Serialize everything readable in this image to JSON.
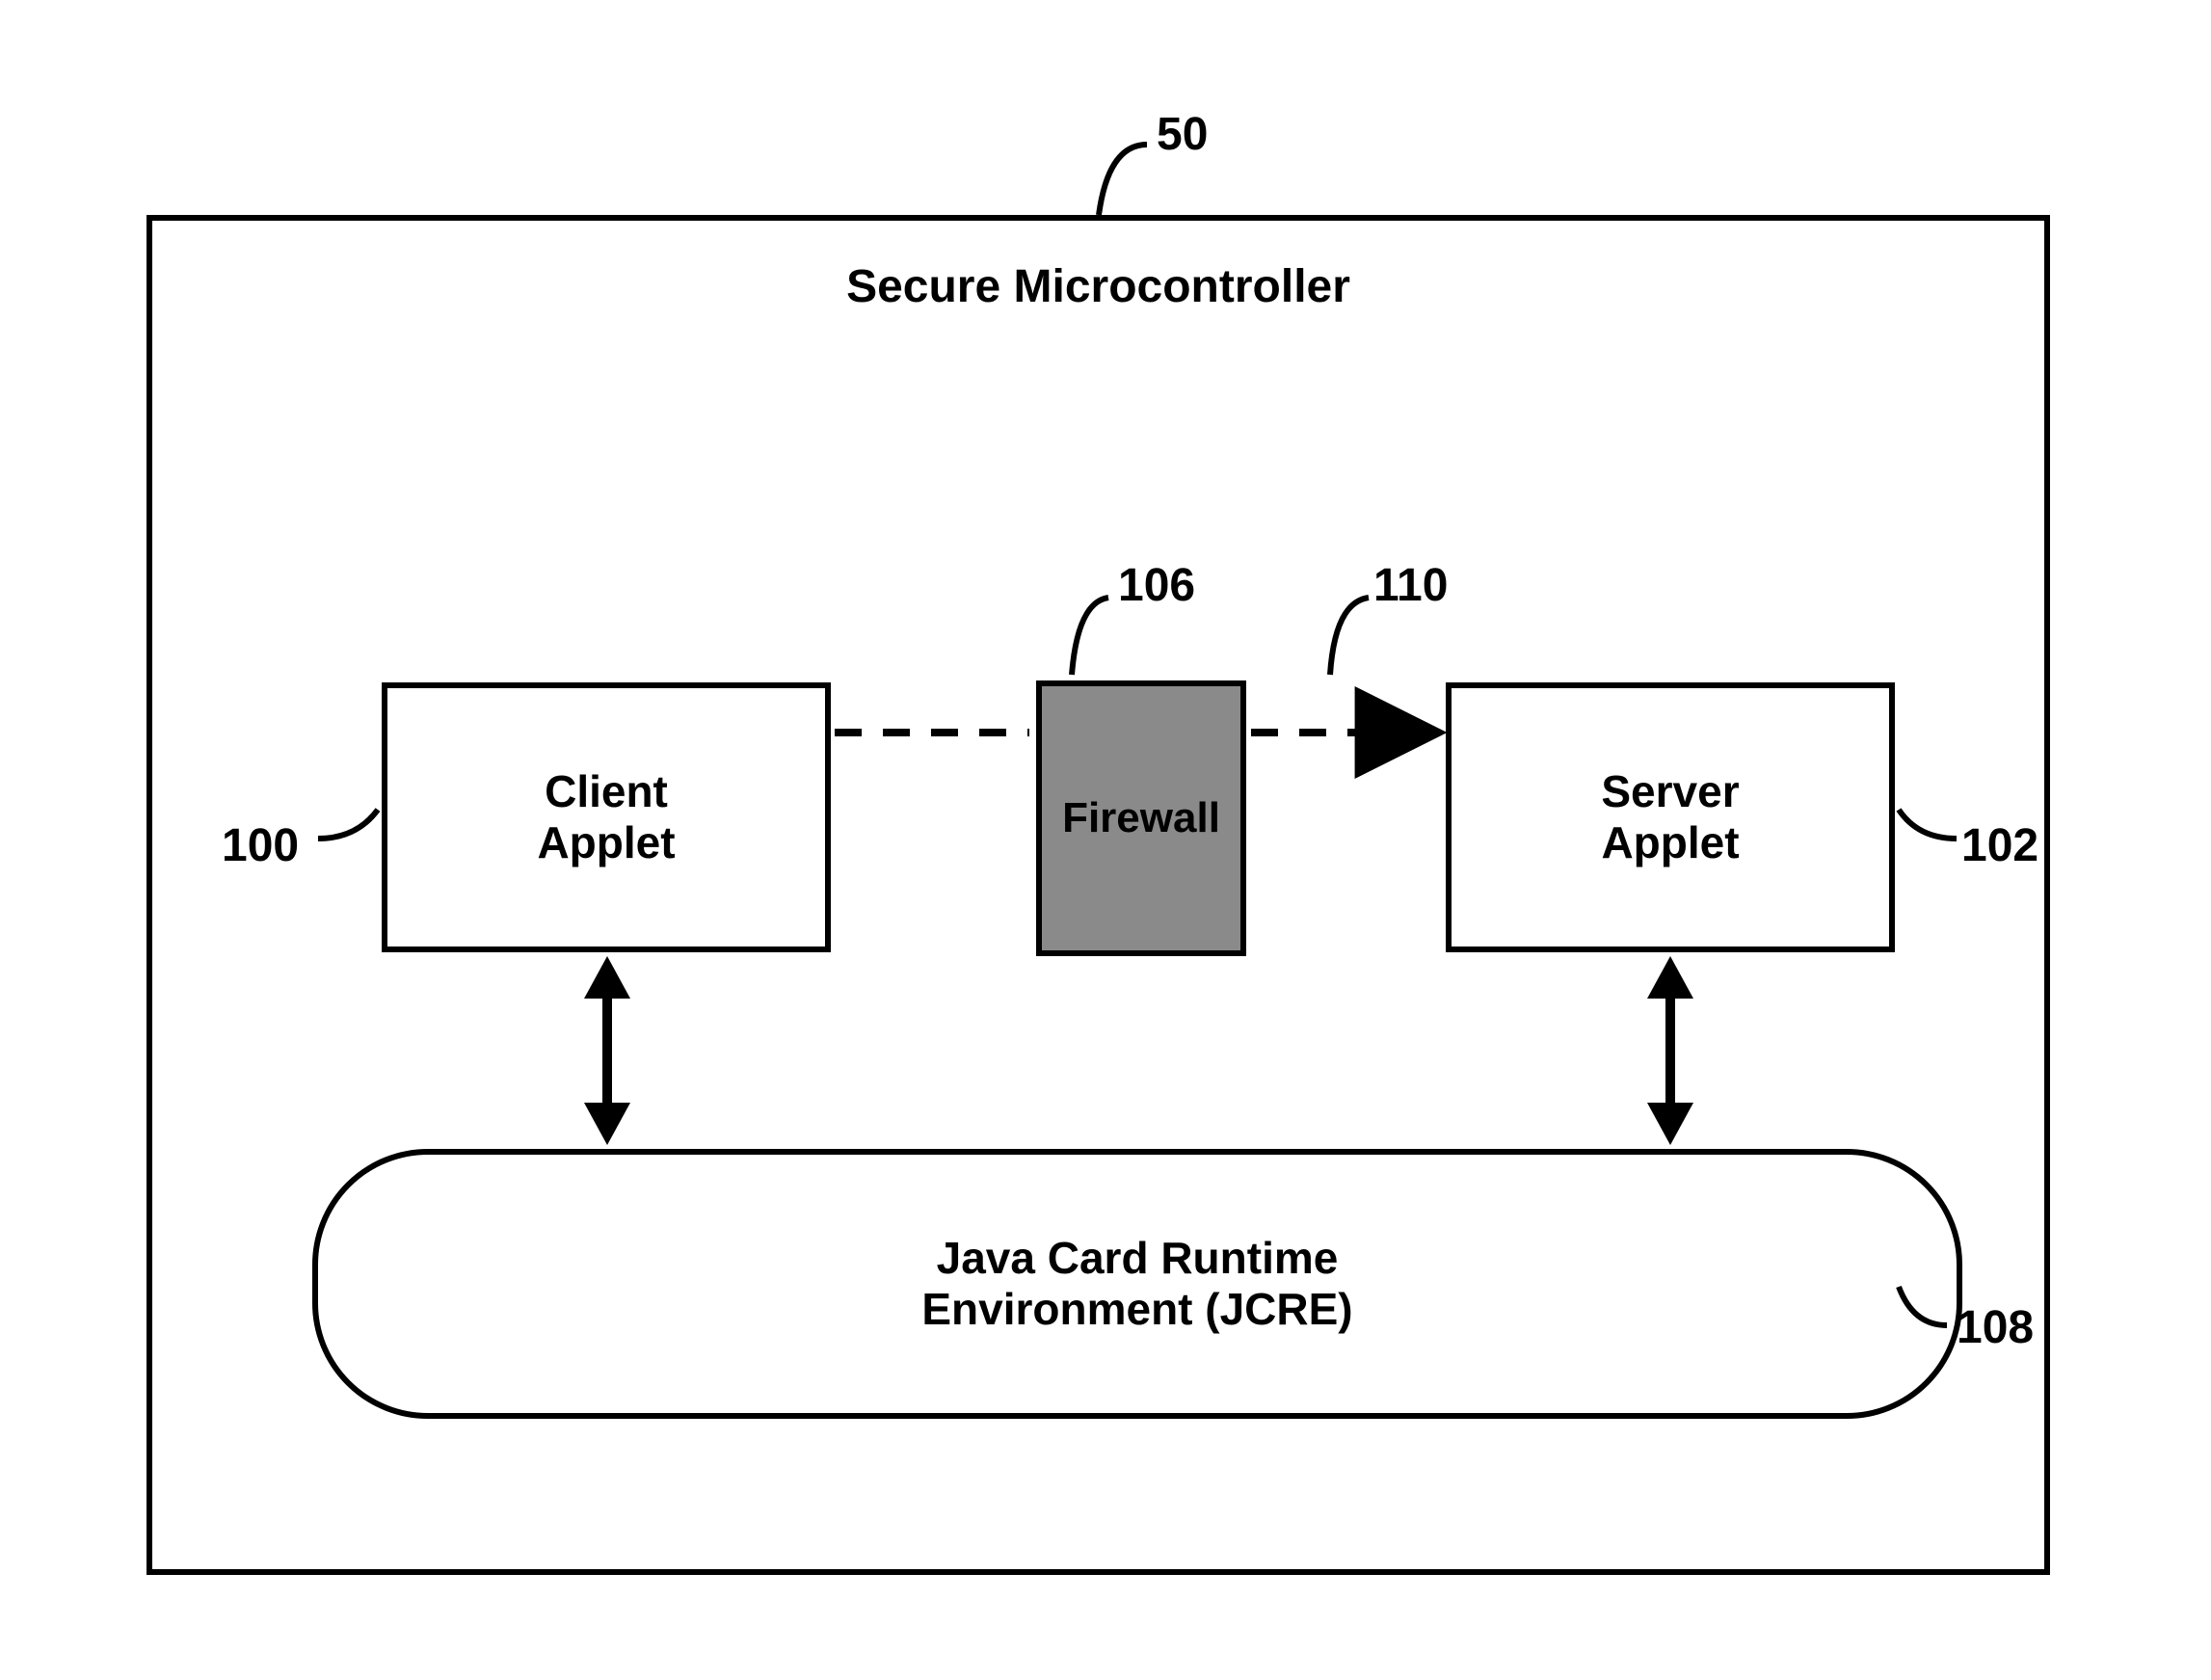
{
  "title": "Secure Microcontroller",
  "client": {
    "line1": "Client",
    "line2": "Applet"
  },
  "firewall": "Firewall",
  "server": {
    "line1": "Server",
    "line2": "Applet"
  },
  "jcre": {
    "line1": "Java Card Runtime",
    "line2": "Environment (JCRE)"
  },
  "labels": {
    "n50": "50",
    "n100": "100",
    "n102": "102",
    "n106": "106",
    "n108": "108",
    "n110": "110"
  }
}
